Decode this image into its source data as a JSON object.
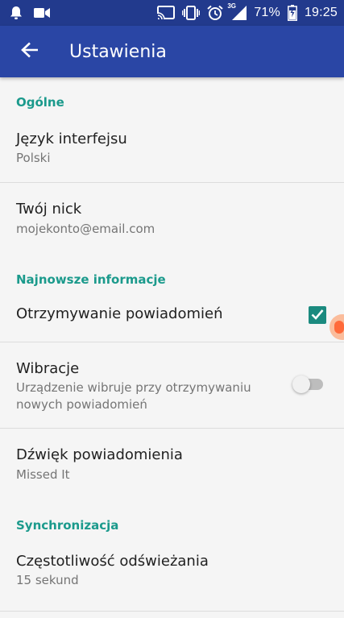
{
  "status_bar": {
    "network_label": "3G",
    "battery_percent": "71%",
    "time": "19:25",
    "icons": [
      "bell-icon",
      "video-camera-icon",
      "cast-icon",
      "vibrate-icon",
      "alarm-clock-icon",
      "signal-icon",
      "battery-icon"
    ]
  },
  "app_bar": {
    "title": "Ustawienia",
    "back_icon": "arrow-left-icon"
  },
  "sections": {
    "general": {
      "header": "Ogólne",
      "language": {
        "title": "Język interfejsu",
        "value": "Polski"
      },
      "nick": {
        "title": "Twój nick",
        "value": "mojekonto@email.com"
      }
    },
    "news": {
      "header": "Najnowsze informacje",
      "notifications": {
        "title": "Otrzymywanie powiadomień",
        "checked": true
      },
      "vibrations": {
        "title": "Wibracje",
        "summary": "Urządzenie wibruje przy otrzymywaniu\nnowych powiadomień",
        "enabled": false
      },
      "sound": {
        "title": "Dźwięk powiadomienia",
        "value": "Missed It"
      }
    },
    "sync": {
      "header": "Synchronizacja",
      "refresh": {
        "title": "Częstotliwość odświeżania",
        "value": "15 sekund"
      }
    }
  },
  "colors": {
    "status_bar": "#223a8d",
    "app_bar": "#2a46a5",
    "accent": "#1b9a8c",
    "background": "#f5f5f5"
  }
}
